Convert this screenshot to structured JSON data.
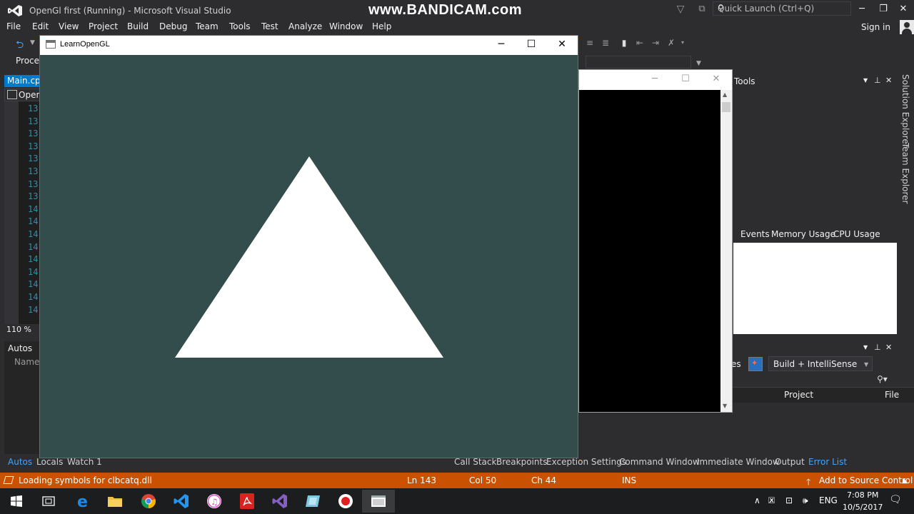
{
  "vs": {
    "title": "OpenGl first (Running) - Microsoft Visual Studio",
    "watermark": "www.BANDICAM.com",
    "quick_launch_placeholder": "Quick Launch (Ctrl+Q)",
    "menu": [
      "File",
      "Edit",
      "View",
      "Project",
      "Build",
      "Debug",
      "Team",
      "Tools",
      "Test",
      "Analyze",
      "Window",
      "Help"
    ],
    "sign_in": "Sign in",
    "process_label": "Proces",
    "editor_tab": "Main.cpp",
    "nav_label": "OpenG",
    "line_numbers": [
      "13",
      "13",
      "13",
      "13",
      "13",
      "13",
      "13",
      "13",
      "14",
      "14",
      "14",
      "14",
      "14",
      "14",
      "14",
      "14",
      "14"
    ],
    "zoom": "110 %",
    "autos_title": "Autos",
    "autos_col_name": "Name",
    "bottom_tabs": [
      "Autos",
      "Locals",
      "Watch 1",
      "Call Stack",
      "Breakpoints",
      "Exception Settings",
      "Command Window",
      "Immediate Window",
      "Output",
      "Error List"
    ],
    "status": {
      "message": "Loading symbols for clbcatq.dll",
      "line": "Ln 143",
      "col": "Col 50",
      "ch": "Ch 44",
      "mode": "INS",
      "source_control": "Add to Source Control"
    },
    "side_tabs": [
      "Solution Explorer",
      "Team Explorer"
    ],
    "diag_title": "Tools",
    "diag_tabs": [
      "Events",
      "Memory Usage",
      "CPU Usage"
    ],
    "error_list": {
      "filter_fragment": "es",
      "build_combo": "Build + IntelliSense",
      "col_project": "Project",
      "col_file": "File"
    },
    "colors": {
      "accent": "#007acc",
      "status_bar": "#ca5100",
      "gl_clear": "#334d4d",
      "gl_border": "#1e7bd8"
    }
  },
  "gl": {
    "title": "LearnOpenGL",
    "triangle_color": "#ffffff"
  },
  "taskbar": {
    "apps": [
      "windows-start-icon",
      "task-view-icon",
      "edge-icon",
      "file-explorer-icon",
      "chrome-icon",
      "vscode-icon",
      "itunes-icon",
      "acrobat-icon",
      "visual-studio-icon",
      "app-icon",
      "record-icon",
      "console-app-icon"
    ],
    "lang": "ENG",
    "time": "7:08 PM",
    "date": "10/5/2017"
  }
}
